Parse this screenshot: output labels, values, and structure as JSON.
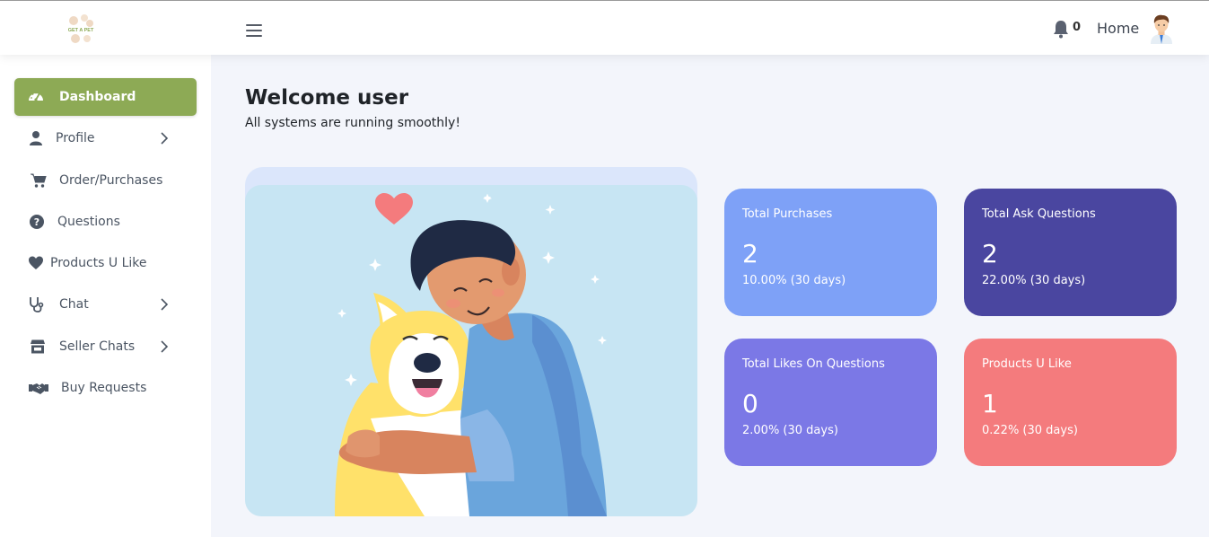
{
  "header": {
    "logo_text": "GET A PET",
    "notification_count": "0",
    "home_label": "Home"
  },
  "sidebar": {
    "items": [
      {
        "label": "Dashboard",
        "icon": "speedometer-icon",
        "active": true
      },
      {
        "label": "Profile",
        "icon": "user-icon",
        "has_submenu": true
      },
      {
        "label": "Order/Purchases",
        "icon": "cart-icon"
      },
      {
        "label": "Questions",
        "icon": "question-circle-icon"
      },
      {
        "label": "Products U Like",
        "icon": "heart-icon"
      },
      {
        "label": "Chat",
        "icon": "stethoscope-icon",
        "has_submenu": true
      },
      {
        "label": "Seller Chats",
        "icon": "store-icon",
        "has_submenu": true
      },
      {
        "label": "Buy Requests",
        "icon": "handshake-icon"
      }
    ]
  },
  "main": {
    "welcome_title": "Welcome user",
    "welcome_subtitle": "All systems are running smoothly!",
    "stats": [
      {
        "title": "Total Purchases",
        "value": "2",
        "change": "10.00% (30 days)",
        "color": "#7ea1f7"
      },
      {
        "title": "Total Ask Questions",
        "value": "2",
        "change": "22.00% (30 days)",
        "color": "#4a46a0"
      },
      {
        "title": "Total Likes On Questions",
        "value": "0",
        "change": "2.00% (30 days)",
        "color": "#7b78e6"
      },
      {
        "title": "Products U Like",
        "value": "1",
        "change": "0.22% (30 days)",
        "color": "#f47b7d"
      }
    ]
  },
  "colors": {
    "accent": "#8daa55",
    "background": "#f3f5fb"
  }
}
